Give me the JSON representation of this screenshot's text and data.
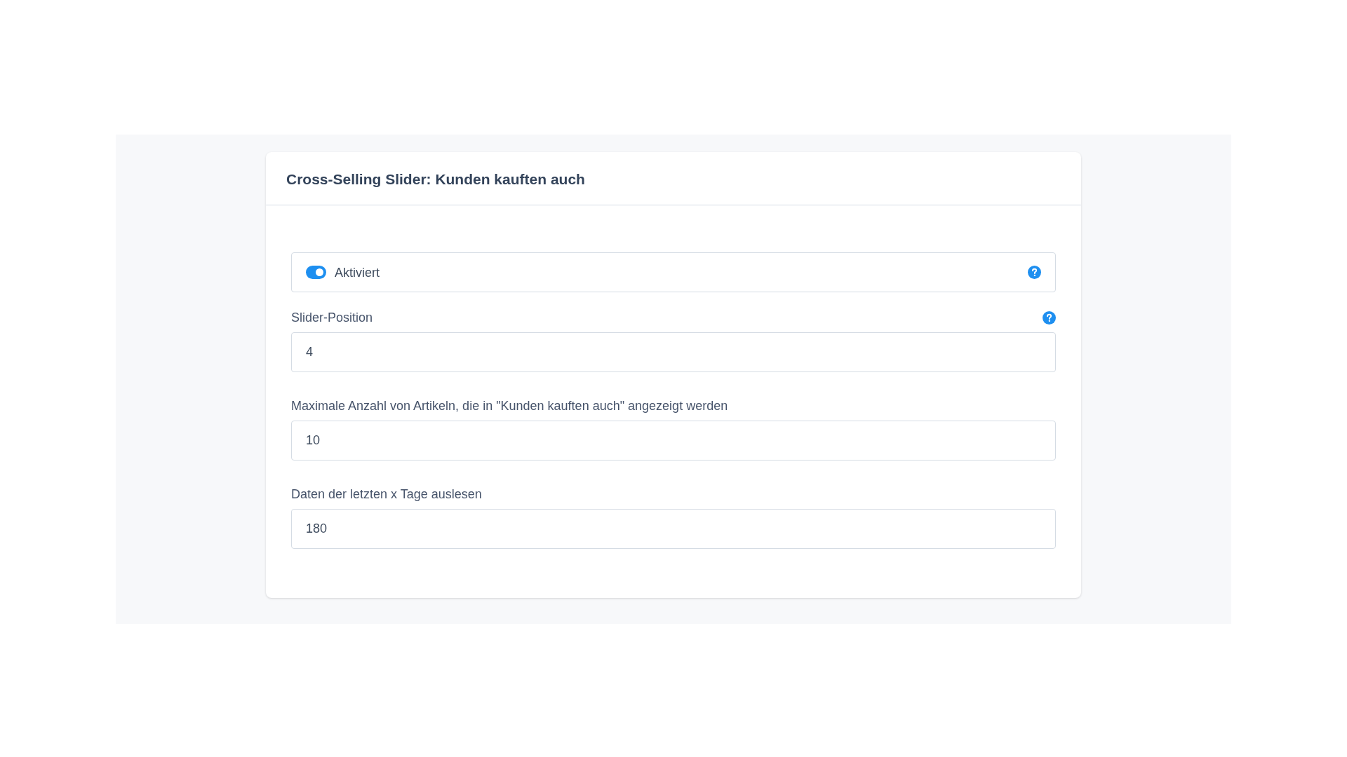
{
  "card": {
    "title": "Cross-Selling Slider: Kunden kauften auch"
  },
  "fields": [
    {
      "kind": "toggle",
      "label": "Aktiviert",
      "on": true,
      "help": true
    },
    {
      "kind": "number",
      "label": "Slider-Position",
      "value": "4",
      "help": true
    },
    {
      "kind": "number",
      "label": "Maximale Anzahl von Artikeln, die in \"Kunden kauften auch\" angezeigt werden",
      "value": "10",
      "help": false
    },
    {
      "kind": "number",
      "label": "Daten der letzten x Tage auslesen",
      "value": "180",
      "help": false
    }
  ]
}
